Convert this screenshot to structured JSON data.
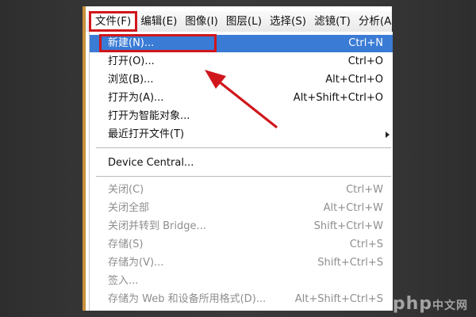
{
  "menubar": {
    "items": [
      {
        "label": "文件(F)"
      },
      {
        "label": "编辑(E)"
      },
      {
        "label": "图像(I)"
      },
      {
        "label": "图层(L)"
      },
      {
        "label": "选择(S)"
      },
      {
        "label": "滤镜(T)"
      },
      {
        "label": "分析(A)"
      }
    ],
    "active_index": 0
  },
  "file_menu": {
    "items": [
      {
        "label": "新建(N)...",
        "shortcut": "Ctrl+N"
      },
      {
        "label": "打开(O)...",
        "shortcut": "Ctrl+O"
      },
      {
        "label": "浏览(B)...",
        "shortcut": "Alt+Ctrl+O"
      },
      {
        "label": "打开为(A)...",
        "shortcut": "Alt+Shift+Ctrl+O"
      },
      {
        "label": "打开为智能对象..."
      },
      {
        "label": "最近打开文件(T)"
      },
      {
        "label": "Device Central..."
      },
      {
        "label": "关闭(C)",
        "shortcut": "Ctrl+W"
      },
      {
        "label": "关闭全部",
        "shortcut": "Alt+Ctrl+W"
      },
      {
        "label": "关闭并转到 Bridge...",
        "shortcut": "Shift+Ctrl+W"
      },
      {
        "label": "存储(S)",
        "shortcut": "Ctrl+S"
      },
      {
        "label": "存储为(V)...",
        "shortcut": "Shift+Ctrl+S"
      },
      {
        "label": "签入..."
      },
      {
        "label": "存储为 Web 和设备所用格式(D)...",
        "shortcut": "Alt+Shift+Ctrl+S"
      }
    ],
    "highlighted_index": 0
  },
  "watermark": {
    "text": "php",
    "suffix": "中文网"
  },
  "colors": {
    "highlight": "#3a7bd5",
    "callout_red": "#d0161b",
    "disabled_text": "#8e8e8e"
  },
  "icons": {
    "pointer_arrow": "red-arrow-icon",
    "submenu": "triangle-right-icon"
  }
}
